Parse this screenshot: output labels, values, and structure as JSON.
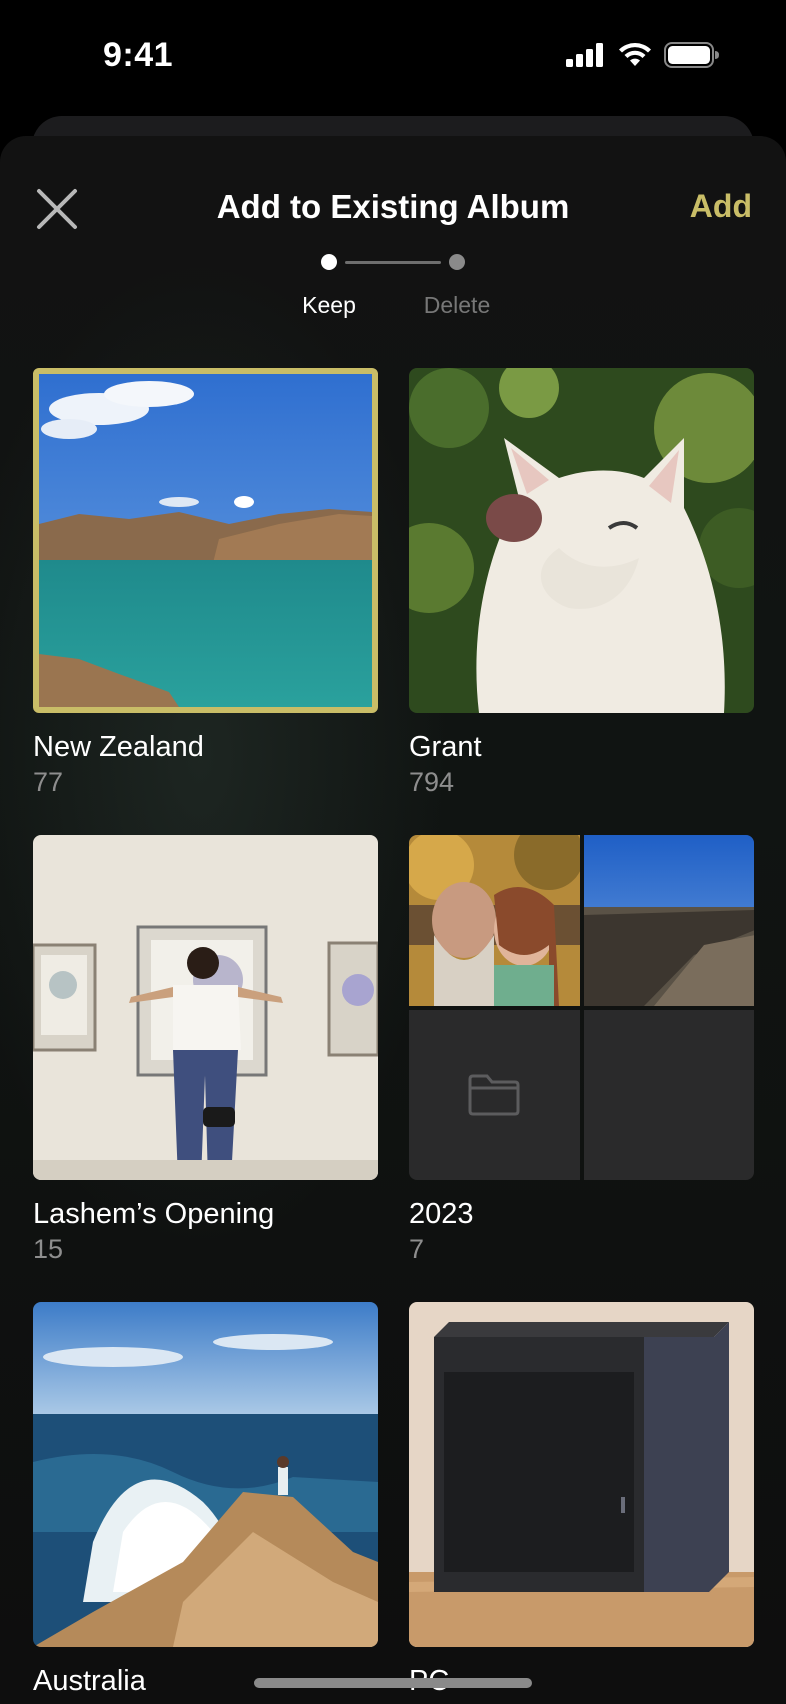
{
  "status_bar": {
    "time": "9:41"
  },
  "header": {
    "title": "Add to Existing Album",
    "add_label": "Add"
  },
  "stepper": {
    "steps": [
      "Keep",
      "Delete"
    ],
    "active_step": "Keep"
  },
  "albums": [
    {
      "name": "New Zealand",
      "count": "77",
      "selected": true
    },
    {
      "name": "Grant",
      "count": "794",
      "selected": false
    },
    {
      "name": "Lashem’s Opening",
      "count": "15",
      "selected": false
    },
    {
      "name": "2023",
      "count": "7",
      "selected": false
    },
    {
      "name": "Australia",
      "count": "",
      "selected": false
    },
    {
      "name": "PC",
      "count": "",
      "selected": false
    }
  ],
  "colors": {
    "accent": "#c9bd67",
    "background": "#000000",
    "secondary_text": "#8e8e8e"
  }
}
